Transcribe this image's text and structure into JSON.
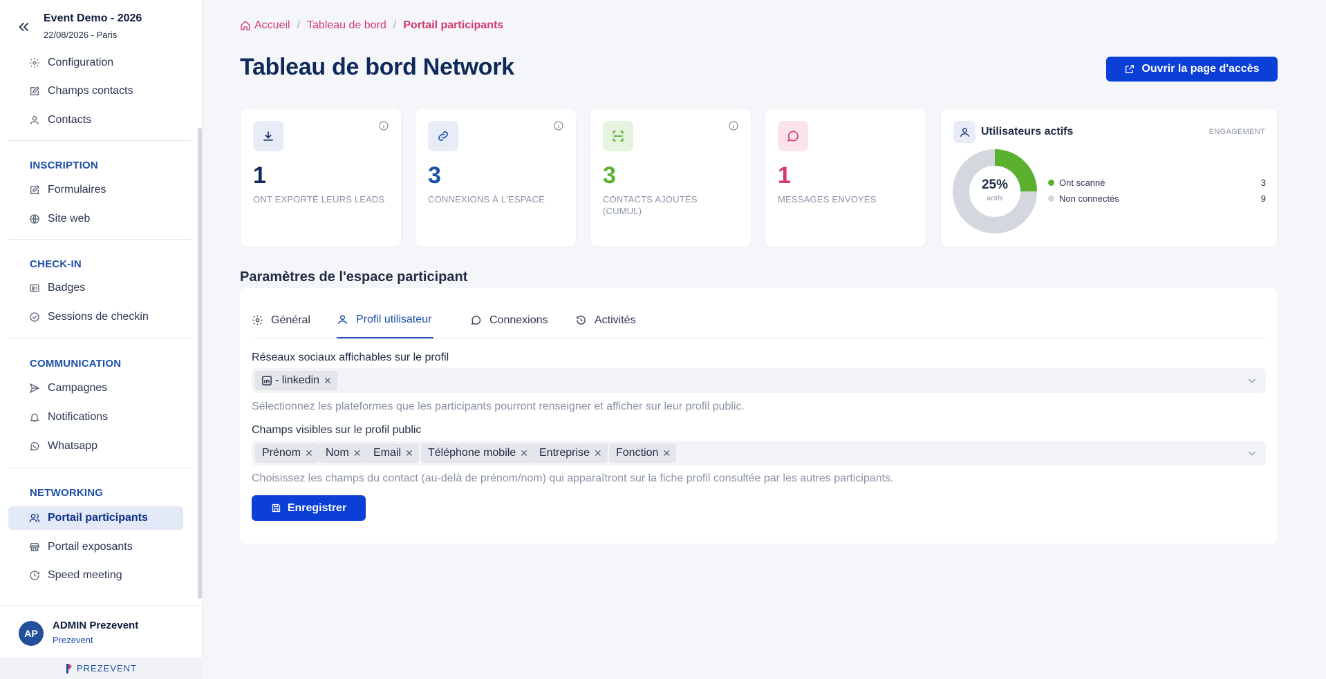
{
  "event": {
    "title": "Event Demo - 2026",
    "date": "22/08/2026 - Paris"
  },
  "sidebar": {
    "top_items": [
      {
        "label": "Configuration",
        "icon": "gear-icon"
      },
      {
        "label": "Champs contacts",
        "icon": "edit-icon"
      },
      {
        "label": "Contacts",
        "icon": "user-icon"
      }
    ],
    "sections": [
      {
        "label": "INSCRIPTION",
        "items": [
          {
            "label": "Formulaires",
            "icon": "edit-icon"
          },
          {
            "label": "Site web",
            "icon": "globe-icon"
          }
        ]
      },
      {
        "label": "CHECK-IN",
        "items": [
          {
            "label": "Badges",
            "icon": "id-card-icon"
          },
          {
            "label": "Sessions de checkin",
            "icon": "check-circle-icon"
          }
        ]
      },
      {
        "label": "COMMUNICATION",
        "items": [
          {
            "label": "Campagnes",
            "icon": "send-icon"
          },
          {
            "label": "Notifications",
            "icon": "bell-icon"
          },
          {
            "label": "Whatsapp",
            "icon": "whatsapp-icon"
          }
        ]
      },
      {
        "label": "NETWORKING",
        "items": [
          {
            "label": "Portail participants",
            "icon": "users-icon",
            "active": true
          },
          {
            "label": "Portail exposants",
            "icon": "store-icon"
          },
          {
            "label": "Speed meeting",
            "icon": "timer-icon"
          }
        ]
      }
    ],
    "user": {
      "initials": "AP",
      "name": "ADMIN Prezevent",
      "org": "Prezevent"
    },
    "brand": "PREZEVENT"
  },
  "breadcrumb": [
    "Accueil",
    "Tableau de bord",
    "Portail participants"
  ],
  "page_title": "Tableau de bord Network",
  "open_button": "Ouvrir la page d'accès",
  "stats": [
    {
      "value": "1",
      "label": "ONT EXPORTÉ LEURS LEADS",
      "icon": "download-icon",
      "color": "#0f2a5a",
      "bg": "#e8ecf8"
    },
    {
      "value": "3",
      "label": "CONNEXIONS À L'ESPACE",
      "icon": "link-icon",
      "color": "#1c4fa8",
      "bg": "#e8ecf8"
    },
    {
      "value": "3",
      "label": "CONTACTS AJOUTÉS (CUMUL)",
      "icon": "scan-icon",
      "color": "#5bb12f",
      "bg": "#e6f3de"
    },
    {
      "value": "1",
      "label": "MESSAGES ENVOYÉS",
      "icon": "message-icon",
      "color": "#d03a6c",
      "bg": "#fbe3eb"
    }
  ],
  "engagement": {
    "title": "Utilisateurs actifs",
    "tag": "ENGAGEMENT",
    "percent": "25%",
    "percent_sub": "actifs",
    "active_fraction": 0.25,
    "legend": [
      {
        "label": "Ont scanné",
        "value": "3",
        "color": "#5bb12f"
      },
      {
        "label": "Non connectés",
        "value": "9",
        "color": "#d4d7de"
      }
    ]
  },
  "settings": {
    "title": "Paramètres de l'espace participant",
    "tabs": [
      {
        "label": "Général",
        "icon": "gear-icon"
      },
      {
        "label": "Profil utilisateur",
        "icon": "user-icon",
        "active": true
      },
      {
        "label": "Connexions",
        "icon": "message-icon"
      },
      {
        "label": "Activités",
        "icon": "history-icon"
      }
    ],
    "social": {
      "label": "Réseaux sociaux affichables sur le profil",
      "chips": [
        "- linkedin"
      ],
      "helper": "Sélectionnez les plateformes que les participants pourront renseigner et afficher sur leur profil public."
    },
    "fields": {
      "label": "Champs visibles sur le profil public",
      "chips": [
        "Prénom",
        "Nom",
        "Email",
        "Téléphone mobile",
        "Entreprise",
        "Fonction"
      ],
      "helper": "Choisissez les champs du contact (au-delà de prénom/nom) qui apparaîtront sur la fiche profil consultée par les autres participants."
    },
    "save_label": "Enregistrer"
  }
}
